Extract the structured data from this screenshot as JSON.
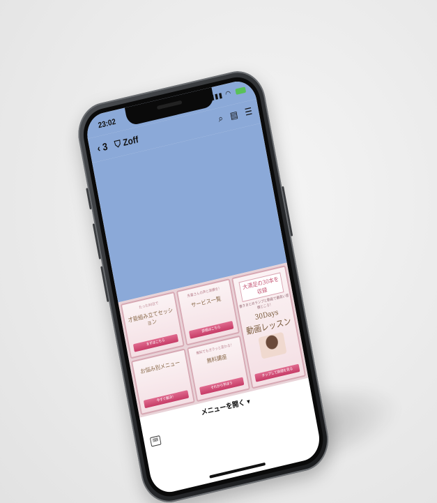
{
  "status_bar": {
    "time": "23:02",
    "signal_icon": "signal-icon",
    "wifi_icon": "wifi-icon",
    "battery_color": "#59c159"
  },
  "nav": {
    "back_label": "3",
    "title": "Zoff",
    "icons": [
      "search-icon",
      "notes-icon",
      "menu-icon"
    ]
  },
  "colors": {
    "chat_background": "#8ba9d8",
    "accent_pink": "#c63b66"
  },
  "rich_menu": {
    "tiles": [
      {
        "top": "たった90日で",
        "main": "才能組み立てセッション",
        "cta": "まずはこちら"
      },
      {
        "top": "先輩さんの声と実績を！",
        "main": "サービス一覧",
        "cta": "詳細はこちら"
      },
      {
        "top": "",
        "main": "お悩み別メニュー",
        "cta": "今すぐ解決！"
      },
      {
        "top": "無料でもガラッと変わる！",
        "main": "無料講座",
        "cta": "それから学ぼう"
      }
    ],
    "big_tile": {
      "banner": "大満足の30本を収録",
      "sub": "書きまとめランプと動画で最高い習慣ところ！",
      "days": "30Days",
      "lesson": "動画レッスン",
      "cta": "タップして詳細を見る"
    }
  },
  "menu_toggle": {
    "label": "メニューを開く ▾"
  }
}
